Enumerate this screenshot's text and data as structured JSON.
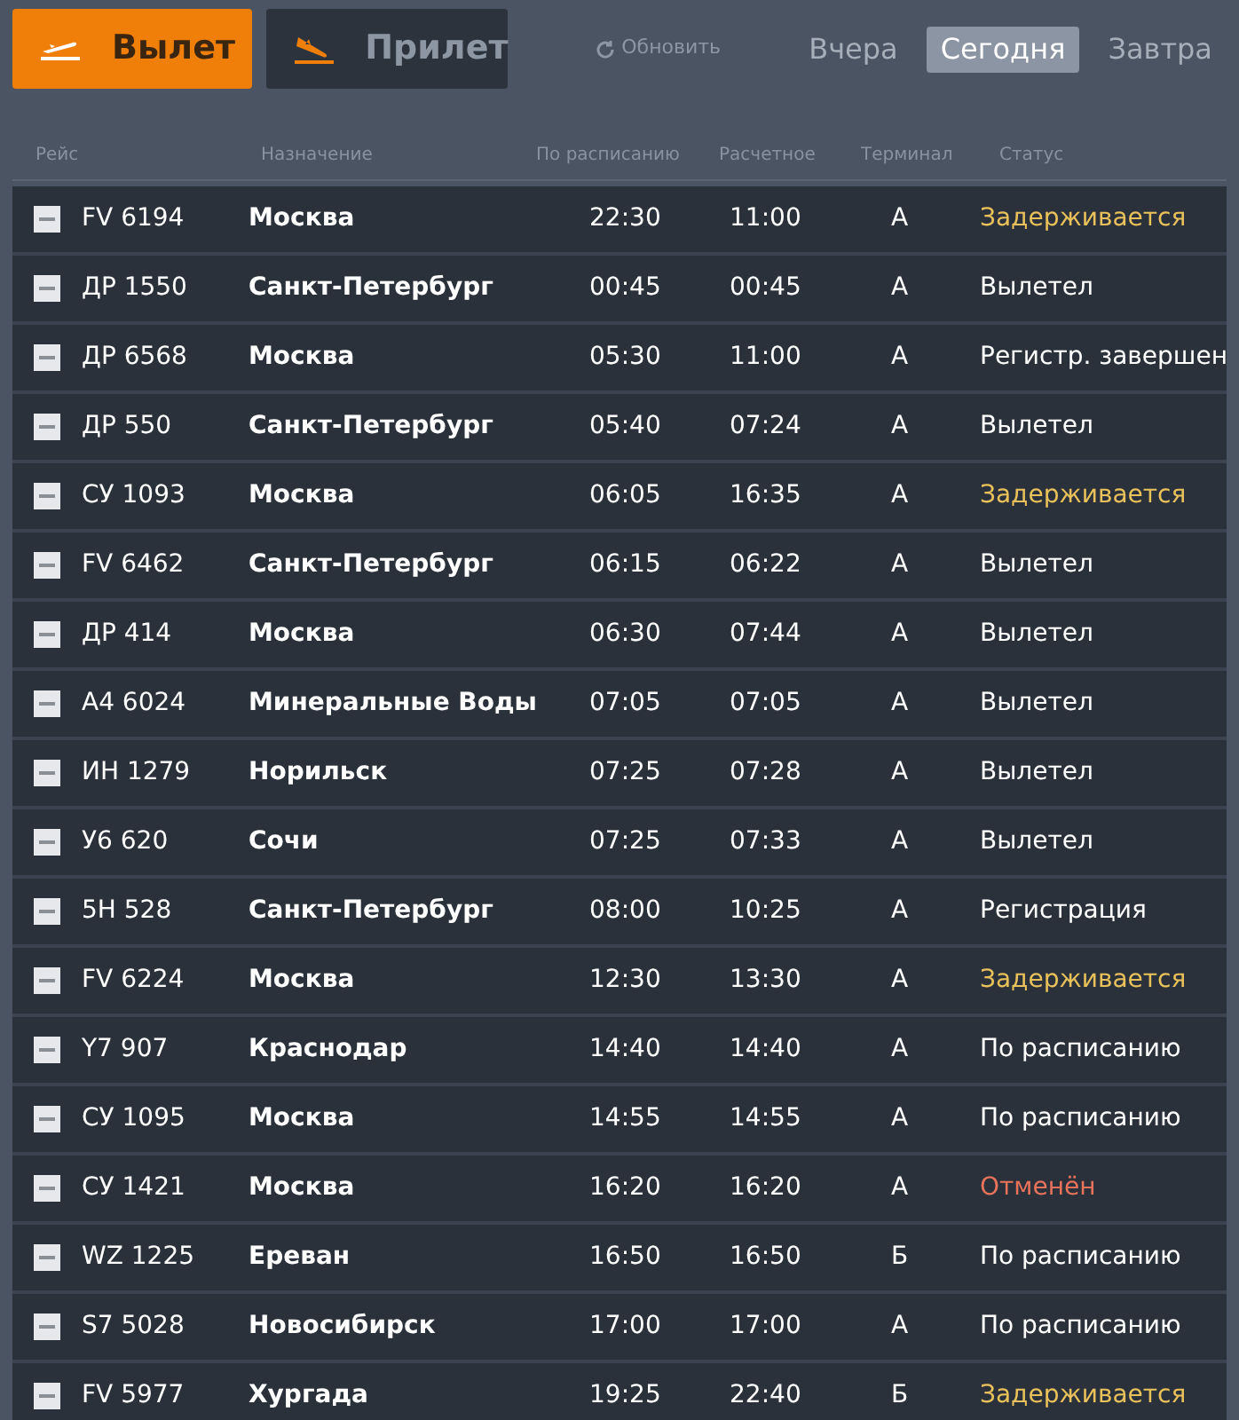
{
  "direction_tabs": [
    {
      "label": "Вылет",
      "kind": "departure",
      "selected": true
    },
    {
      "label": "Прилет",
      "kind": "arrival",
      "selected": false
    }
  ],
  "refresh": {
    "label": "Обновить"
  },
  "day_tabs": [
    {
      "label": "Вчера",
      "selected": false
    },
    {
      "label": "Сегодня",
      "selected": true
    },
    {
      "label": "Завтра",
      "selected": false
    }
  ],
  "table": {
    "columns": [
      "Рейс",
      "Назначение",
      "По расписанию",
      "Расчетное",
      "Терминал",
      "Статус"
    ],
    "rows": [
      {
        "flight": "FV 6194",
        "destination": "Москва",
        "scheduled": "22:30",
        "estimated": "11:00",
        "terminal": "A",
        "status": "Задерживается",
        "color": "#e8c15a"
      },
      {
        "flight": "ДР 1550",
        "destination": "Санкт-Петербург",
        "scheduled": "00:45",
        "estimated": "00:45",
        "terminal": "A",
        "status": "Вылетел",
        "color": "#ffffff"
      },
      {
        "flight": "ДР 6568",
        "destination": "Москва",
        "scheduled": "05:30",
        "estimated": "11:00",
        "terminal": "A",
        "status": "Регистр. завершен",
        "color": "#ffffff"
      },
      {
        "flight": "ДР 550",
        "destination": "Санкт-Петербург",
        "scheduled": "05:40",
        "estimated": "07:24",
        "terminal": "A",
        "status": "Вылетел",
        "color": "#ffffff"
      },
      {
        "flight": "СУ 1093",
        "destination": "Москва",
        "scheduled": "06:05",
        "estimated": "16:35",
        "terminal": "A",
        "status": "Задерживается",
        "color": "#e8c15a"
      },
      {
        "flight": "FV 6462",
        "destination": "Санкт-Петербург",
        "scheduled": "06:15",
        "estimated": "06:22",
        "terminal": "A",
        "status": "Вылетел",
        "color": "#ffffff"
      },
      {
        "flight": "ДР 414",
        "destination": "Москва",
        "scheduled": "06:30",
        "estimated": "07:44",
        "terminal": "A",
        "status": "Вылетел",
        "color": "#ffffff"
      },
      {
        "flight": "А4 6024",
        "destination": "Минеральные Воды",
        "scheduled": "07:05",
        "estimated": "07:05",
        "terminal": "A",
        "status": "Вылетел",
        "color": "#ffffff"
      },
      {
        "flight": "ИН 1279",
        "destination": "Норильск",
        "scheduled": "07:25",
        "estimated": "07:28",
        "terminal": "A",
        "status": "Вылетел",
        "color": "#ffffff"
      },
      {
        "flight": "У6 620",
        "destination": "Сочи",
        "scheduled": "07:25",
        "estimated": "07:33",
        "terminal": "A",
        "status": "Вылетел",
        "color": "#ffffff"
      },
      {
        "flight": "5Н 528",
        "destination": "Санкт-Петербург",
        "scheduled": "08:00",
        "estimated": "10:25",
        "terminal": "A",
        "status": "Регистрация",
        "color": "#ffffff"
      },
      {
        "flight": "FV 6224",
        "destination": "Москва",
        "scheduled": "12:30",
        "estimated": "13:30",
        "terminal": "A",
        "status": "Задерживается",
        "color": "#e8c15a"
      },
      {
        "flight": "Y7 907",
        "destination": "Краснодар",
        "scheduled": "14:40",
        "estimated": "14:40",
        "terminal": "A",
        "status": "По расписанию",
        "color": "#ffffff"
      },
      {
        "flight": "СУ 1095",
        "destination": "Москва",
        "scheduled": "14:55",
        "estimated": "14:55",
        "terminal": "A",
        "status": "По расписанию",
        "color": "#ffffff"
      },
      {
        "flight": "СУ 1421",
        "destination": "Москва",
        "scheduled": "16:20",
        "estimated": "16:20",
        "terminal": "A",
        "status": "Отменён",
        "color": "#e8735a"
      },
      {
        "flight": "WZ 1225",
        "destination": "Ереван",
        "scheduled": "16:50",
        "estimated": "16:50",
        "terminal": "Б",
        "status": "По расписанию",
        "color": "#ffffff"
      },
      {
        "flight": "S7 5028",
        "destination": "Новосибирск",
        "scheduled": "17:00",
        "estimated": "17:00",
        "terminal": "A",
        "status": "По расписанию",
        "color": "#ffffff"
      },
      {
        "flight": "FV 5977",
        "destination": "Хургада",
        "scheduled": "19:25",
        "estimated": "22:40",
        "terminal": "Б",
        "status": "Задерживается",
        "color": "#e8c15a"
      }
    ]
  }
}
